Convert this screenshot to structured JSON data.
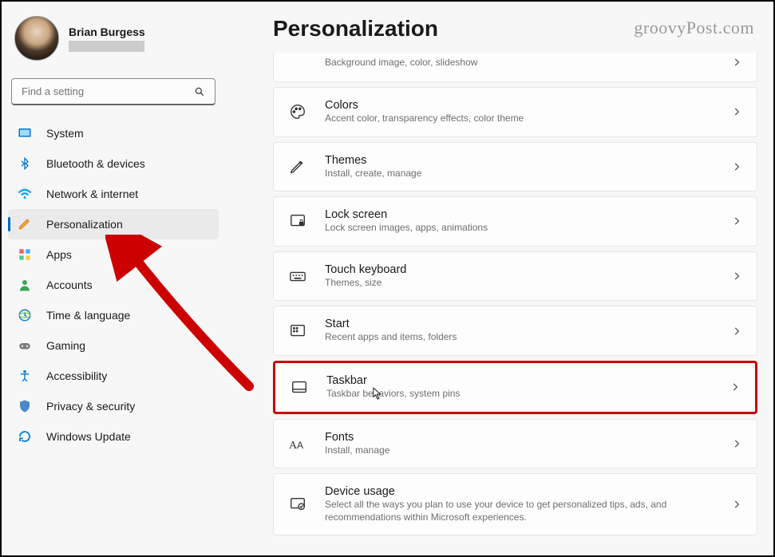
{
  "user": {
    "name": "Brian Burgess"
  },
  "search": {
    "placeholder": "Find a setting"
  },
  "nav": [
    {
      "label": "System",
      "icon": "system"
    },
    {
      "label": "Bluetooth & devices",
      "icon": "bluetooth"
    },
    {
      "label": "Network & internet",
      "icon": "network"
    },
    {
      "label": "Personalization",
      "icon": "personalization",
      "selected": true
    },
    {
      "label": "Apps",
      "icon": "apps"
    },
    {
      "label": "Accounts",
      "icon": "accounts"
    },
    {
      "label": "Time & language",
      "icon": "time"
    },
    {
      "label": "Gaming",
      "icon": "gaming"
    },
    {
      "label": "Accessibility",
      "icon": "accessibility"
    },
    {
      "label": "Privacy & security",
      "icon": "privacy"
    },
    {
      "label": "Windows Update",
      "icon": "update"
    }
  ],
  "page": {
    "title": "Personalization"
  },
  "cards": {
    "partial": {
      "sub": "Background image, color, slideshow"
    },
    "colors": {
      "title": "Colors",
      "sub": "Accent color, transparency effects, color theme"
    },
    "themes": {
      "title": "Themes",
      "sub": "Install, create, manage"
    },
    "lockscreen": {
      "title": "Lock screen",
      "sub": "Lock screen images, apps, animations"
    },
    "touchkeyboard": {
      "title": "Touch keyboard",
      "sub": "Themes, size"
    },
    "start": {
      "title": "Start",
      "sub": "Recent apps and items, folders"
    },
    "taskbar": {
      "title": "Taskbar",
      "sub": "Taskbar behaviors, system pins"
    },
    "fonts": {
      "title": "Fonts",
      "sub": "Install, manage"
    },
    "deviceusage": {
      "title": "Device usage",
      "sub": "Select all the ways you plan to use your device to get personalized tips, ads, and recommendations within Microsoft experiences."
    }
  },
  "watermark": "groovyPost.com"
}
